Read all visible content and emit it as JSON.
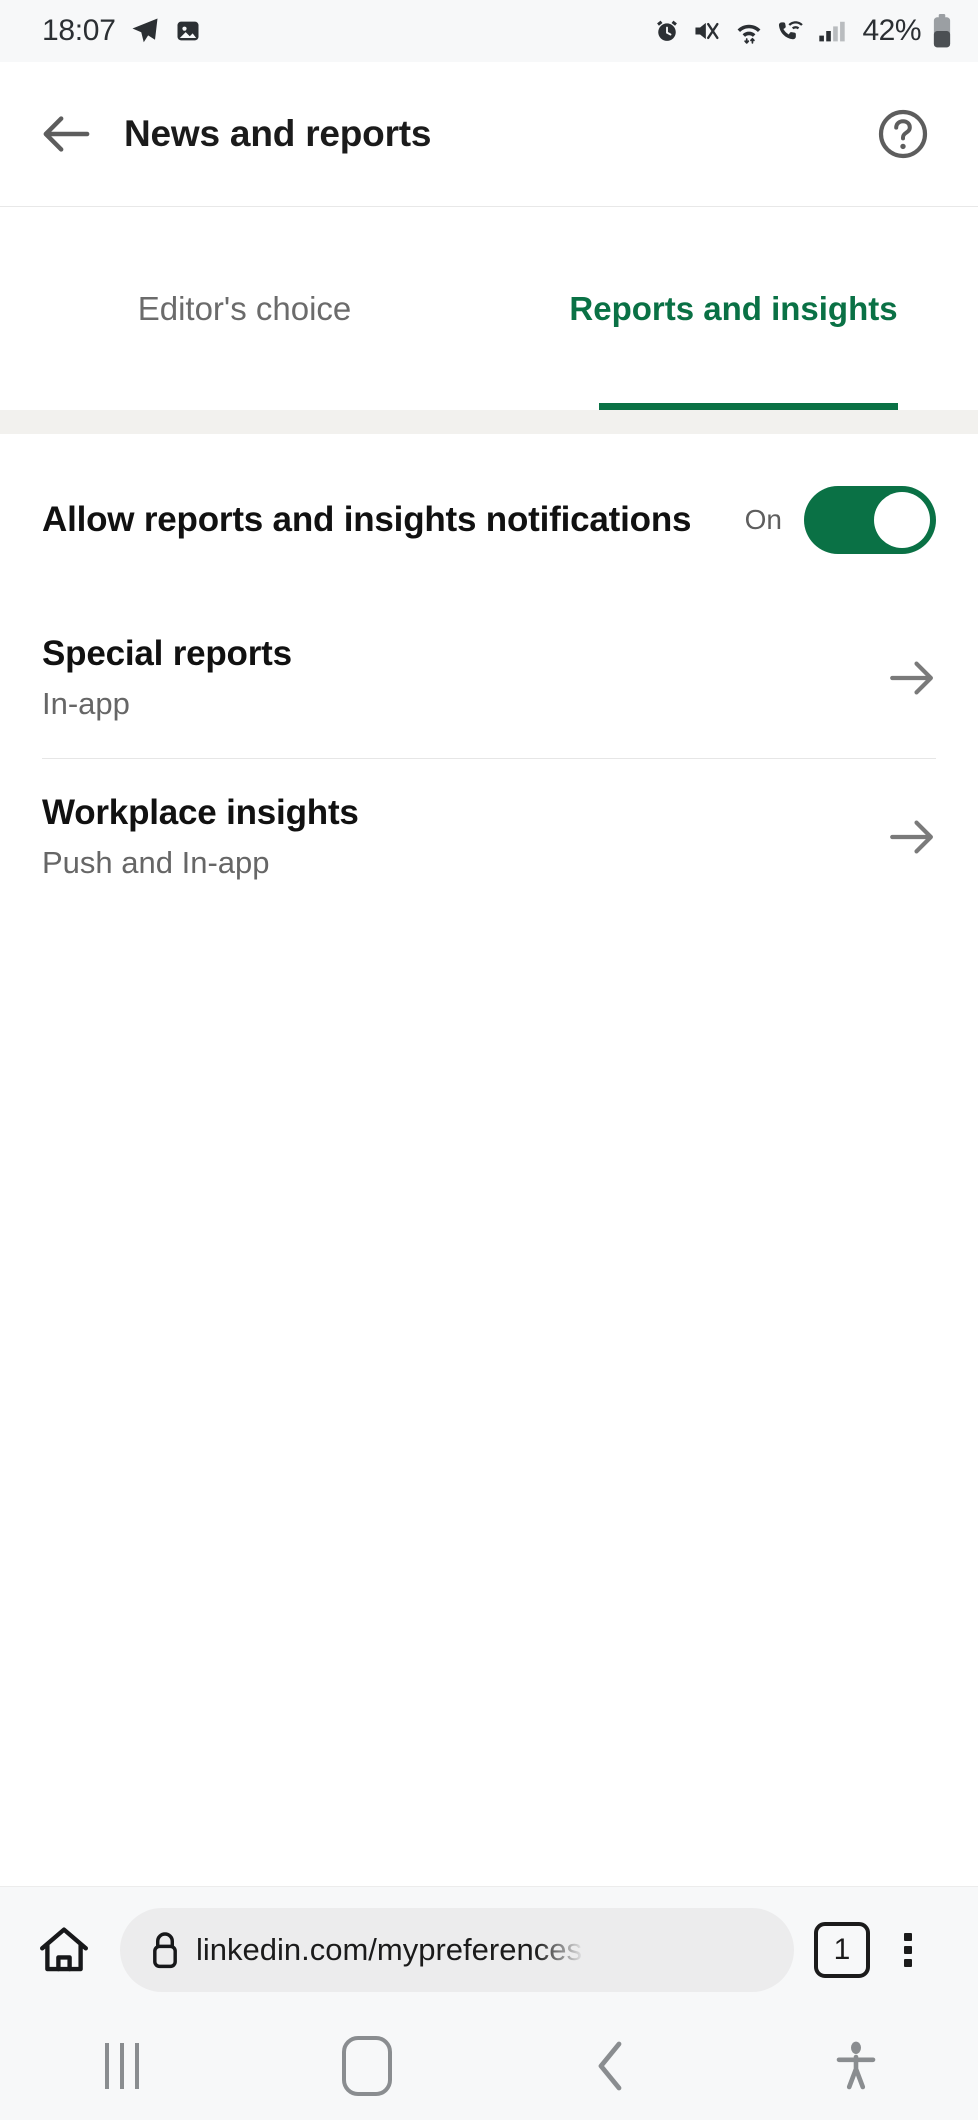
{
  "status_bar": {
    "time": "18:07",
    "battery_percent": "42%",
    "left_icons": [
      "telegram-send-icon",
      "image-icon"
    ],
    "right_icons": [
      "alarm-icon",
      "mute-vibrate-icon",
      "wifi-data-icon",
      "wifi-calling-icon",
      "signal-bars-icon",
      "battery-icon"
    ]
  },
  "app_bar": {
    "back_icon": "back-arrow-icon",
    "title": "News and reports",
    "help_icon": "help-circle-icon"
  },
  "tabs": [
    {
      "label": "Editor's choice",
      "active": false
    },
    {
      "label": "Reports and insights",
      "active": true
    }
  ],
  "settings": {
    "toggle_row": {
      "label": "Allow reports and insights notifications",
      "state_label": "On",
      "state_on": true
    },
    "links": [
      {
        "title": "Special reports",
        "subtitle": "In-app",
        "arrow_icon": "arrow-right-icon"
      },
      {
        "title": "Workplace insights",
        "subtitle": "Push and In-app",
        "arrow_icon": "arrow-right-icon"
      }
    ]
  },
  "browser_bar": {
    "home_icon": "home-icon",
    "lock_icon": "lock-icon",
    "url": "linkedin.com/mypreferences",
    "tab_count": "1",
    "menu_icon": "overflow-menu-icon"
  },
  "nav_bar": {
    "recents_icon": "recents-icon",
    "home_icon": "home-square-icon",
    "back_icon": "back-chevron-icon",
    "accessibility_icon": "accessibility-icon"
  },
  "colors": {
    "accent_green": "#0a7145",
    "inactive_tab": "#6b6b6b",
    "status_bar_bg": "#f7f8f9",
    "band_bg": "#f2f1ee"
  }
}
